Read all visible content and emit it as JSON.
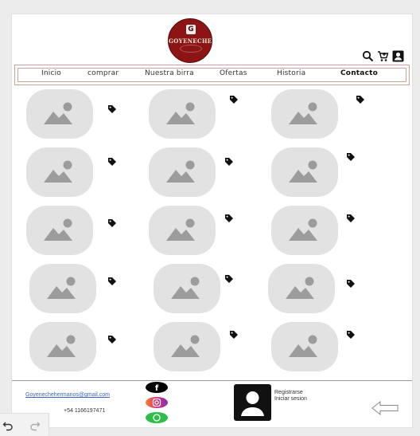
{
  "logo": {
    "letter": "G",
    "brand": "GOYENECHE"
  },
  "header_icons": [
    "search-icon",
    "cart-icon",
    "account-icon"
  ],
  "nav": {
    "items": [
      "Inicio",
      "comprar",
      "Nuestra birra",
      "Ofertas",
      "Historia",
      "Contacto"
    ]
  },
  "products": {
    "rows": 5,
    "columns": 3,
    "image_icon": "image-placeholder-icon",
    "tag_icon": "price-tag-icon"
  },
  "footer": {
    "email": "Goyenechehermanos@gmail.com",
    "phone": "+54 1166197471",
    "social": [
      "facebook-icon",
      "instagram-icon",
      "whatsapp-icon"
    ],
    "auth": {
      "register": "Registrarse",
      "login": "Iniciar sesion"
    },
    "back_icon": "arrow-left-icon"
  },
  "toolbar": {
    "undo_icon": "undo-icon",
    "redo_icon": "redo-icon"
  },
  "colors": {
    "logo": "#8c1414",
    "nav_border": "#caa69a",
    "placeholder": "#e2e2e2",
    "link": "#3a64c8"
  }
}
